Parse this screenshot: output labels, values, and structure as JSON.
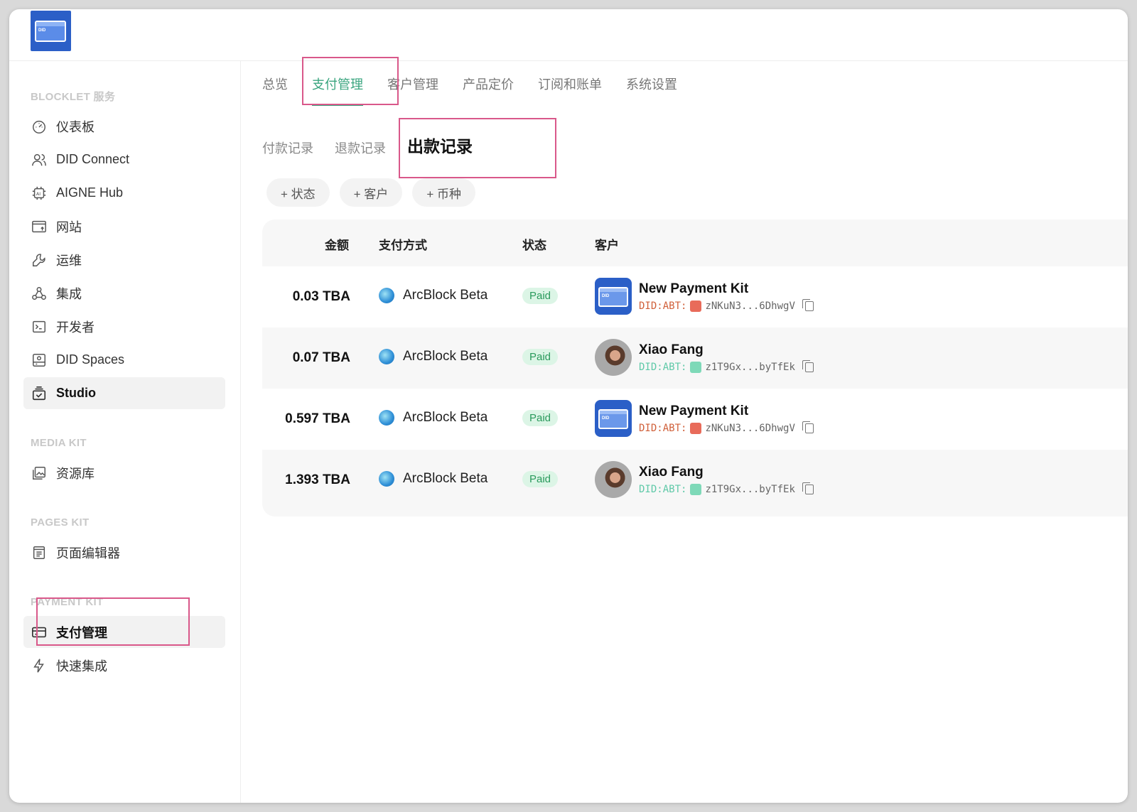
{
  "app": {
    "logo_text": "DID"
  },
  "sidebar": {
    "sections": [
      {
        "title": "BLOCKLET 服务",
        "items": [
          {
            "label": "仪表板",
            "icon": "dashboard-icon"
          },
          {
            "label": "DID Connect",
            "icon": "users-icon"
          },
          {
            "label": "AIGNE Hub",
            "icon": "ai-chip-icon"
          },
          {
            "label": "网站",
            "icon": "website-icon"
          },
          {
            "label": "运维",
            "icon": "wrench-icon"
          },
          {
            "label": "集成",
            "icon": "webhook-icon"
          },
          {
            "label": "开发者",
            "icon": "terminal-icon"
          },
          {
            "label": "DID Spaces",
            "icon": "drive-icon"
          },
          {
            "label": "Studio",
            "icon": "studio-icon",
            "active": true
          }
        ]
      },
      {
        "title": "MEDIA KIT",
        "items": [
          {
            "label": "资源库",
            "icon": "image-library-icon"
          }
        ]
      },
      {
        "title": "PAGES KIT",
        "items": [
          {
            "label": "页面编辑器",
            "icon": "page-editor-icon"
          }
        ]
      },
      {
        "title": "PAYMENT KIT",
        "items": [
          {
            "label": "支付管理",
            "icon": "payment-card-icon",
            "active": true
          },
          {
            "label": "快速集成",
            "icon": "lightning-icon"
          }
        ]
      }
    ]
  },
  "tabs": [
    "总览",
    "支付管理",
    "客户管理",
    "产品定价",
    "订阅和账单",
    "系统设置"
  ],
  "active_tab": 1,
  "subtabs": [
    "付款记录",
    "退款记录",
    "出款记录"
  ],
  "active_subtab": 2,
  "filters": [
    "+ 状态",
    "+ 客户",
    "+ 币种"
  ],
  "table": {
    "headers": {
      "amount": "金额",
      "method": "支付方式",
      "status": "状态",
      "customer": "客户"
    },
    "rows": [
      {
        "amount": "0.03 TBA",
        "method": "ArcBlock Beta",
        "status": "Paid",
        "customer": "New Payment Kit",
        "did_prefix": "DID:ABT:",
        "did": "zNKuN3...6DhwgV",
        "avatar": "app",
        "did_color": "#d0603a",
        "dot_color": "#e86b5a"
      },
      {
        "amount": "0.07 TBA",
        "method": "ArcBlock Beta",
        "status": "Paid",
        "customer": "Xiao Fang",
        "did_prefix": "DID:ABT:",
        "did": "z1T9Gx...byTfEk",
        "avatar": "photo",
        "did_color": "#5fc9a8",
        "dot_color": "#7ed9b8"
      },
      {
        "amount": "0.597 TBA",
        "method": "ArcBlock Beta",
        "status": "Paid",
        "customer": "New Payment Kit",
        "did_prefix": "DID:ABT:",
        "did": "zNKuN3...6DhwgV",
        "avatar": "app",
        "did_color": "#d0603a",
        "dot_color": "#e86b5a"
      },
      {
        "amount": "1.393 TBA",
        "method": "ArcBlock Beta",
        "status": "Paid",
        "customer": "Xiao Fang",
        "did_prefix": "DID:ABT:",
        "did": "z1T9Gx...byTfEk",
        "avatar": "photo",
        "did_color": "#5fc9a8",
        "dot_color": "#7ed9b8"
      }
    ]
  },
  "colors": {
    "accent": "#3aa57f",
    "highlight": "#d9588a",
    "paid_bg": "#dcf5e6",
    "paid_text": "#2a9a5c"
  }
}
